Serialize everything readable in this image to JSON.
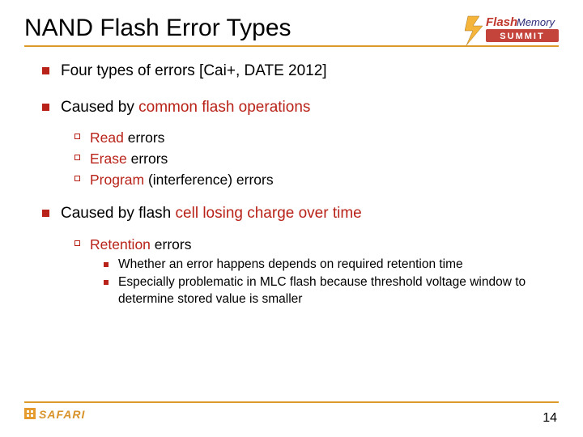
{
  "title": "NAND Flash Error Types",
  "bullets": [
    {
      "pre": "Four types of errors [Cai+, DATE 2012]",
      "accent": "",
      "post": ""
    },
    {
      "pre": "Caused by ",
      "accent": "common flash operations",
      "post": ""
    },
    {
      "pre": "Caused by flash ",
      "accent": "cell losing charge over time",
      "post": ""
    }
  ],
  "ops": [
    {
      "accent": "Read",
      "post": " errors"
    },
    {
      "accent": "Erase",
      "post": " errors"
    },
    {
      "accent": "Program",
      "post": " (interference) errors"
    }
  ],
  "retention": {
    "accent": "Retention",
    "post": " errors",
    "subs": [
      "Whether an error happens depends on required retention time",
      "Especially problematic in MLC flash because threshold voltage window to determine stored value is smaller"
    ]
  },
  "page": "14",
  "logos": {
    "fms_flash": "Flash",
    "fms_memory": "Memory",
    "fms_summit": "SUMMIT",
    "safari": "SAFARI"
  }
}
